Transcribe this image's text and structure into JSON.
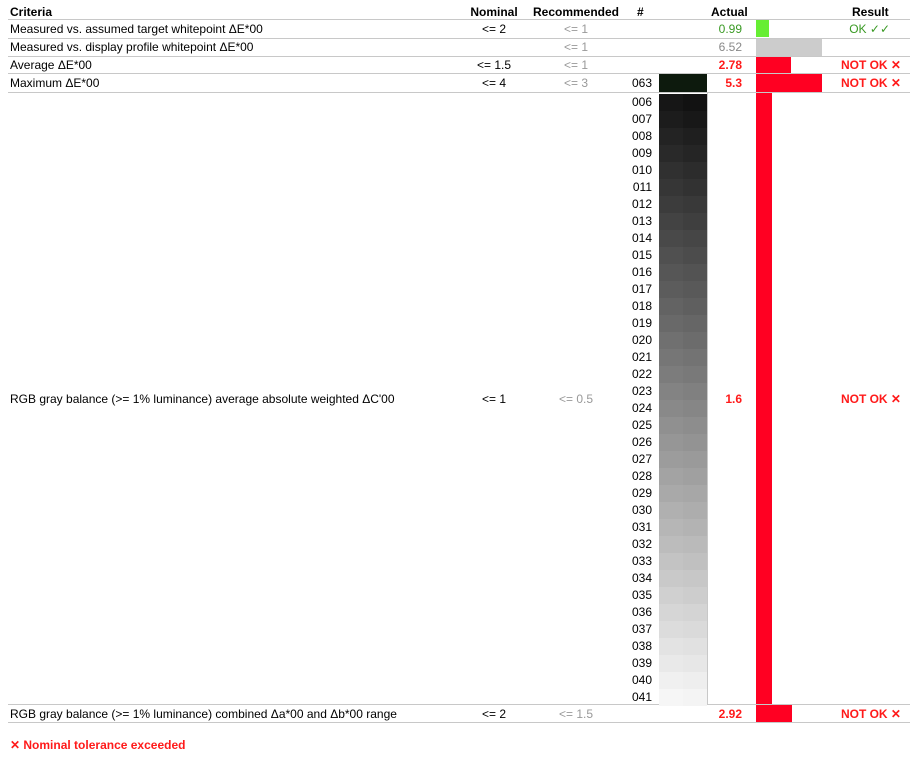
{
  "headers": {
    "criteria": "Criteria",
    "nominal": "Nominal",
    "recommended": "Recommended",
    "hash": "#",
    "actual": "Actual",
    "result": "Result"
  },
  "rows": [
    {
      "criteria": "Measured vs. assumed target whitepoint ΔE*00",
      "nominal": "<= 2",
      "recommended": "<= 1",
      "patch": "",
      "actual": "0.99",
      "result": "OK ✓✓",
      "bar_fraction": 0.19,
      "bar_color": "#66ee33"
    },
    {
      "criteria": "Measured vs. display profile whitepoint ΔE*00",
      "nominal": "",
      "recommended": "<= 1",
      "patch": "",
      "actual": "6.52",
      "result": "",
      "bar_fraction": 1.0,
      "bar_color": "#cccccc"
    },
    {
      "criteria": "Average ΔE*00",
      "nominal": "<= 1.5",
      "recommended": "<= 1",
      "patch": "",
      "actual": "2.78",
      "result": "NOT OK ✕",
      "bar_fraction": 0.53,
      "bar_color": "#ff0022"
    },
    {
      "criteria": "Maximum ΔE*00",
      "nominal": "<= 4",
      "recommended": "<= 3",
      "patch": "063",
      "actual": "5.3",
      "result": "NOT OK ✕",
      "bar_fraction": 1.0,
      "bar_color": "#ff0022"
    },
    {
      "criteria": "RGB gray balance (>= 1% luminance) average absolute weighted ΔC'00",
      "nominal": "<= 1",
      "recommended": "<= 0.5",
      "patch": "",
      "actual": "1.6",
      "result": "NOT OK ✕",
      "bar_fraction": 0.3,
      "bar_color": "#ff0022"
    },
    {
      "criteria": "RGB gray balance (>= 1% luminance) combined Δa*00 and Δb*00 range",
      "nominal": "<= 2",
      "recommended": "<= 1.5",
      "patch": "",
      "actual": "2.92",
      "result": "NOT OK ✕",
      "bar_fraction": 0.55,
      "bar_color": "#ff0022"
    }
  ],
  "gray_patches": [
    "006",
    "007",
    "008",
    "009",
    "010",
    "011",
    "012",
    "013",
    "014",
    "015",
    "016",
    "017",
    "018",
    "019",
    "020",
    "021",
    "022",
    "023",
    "024",
    "025",
    "026",
    "027",
    "028",
    "029",
    "030",
    "031",
    "032",
    "033",
    "034",
    "035",
    "036",
    "037",
    "038",
    "039",
    "040",
    "041"
  ],
  "max_patch_color": "#0d1a0d",
  "footer": "✕ Nominal tolerance exceeded"
}
